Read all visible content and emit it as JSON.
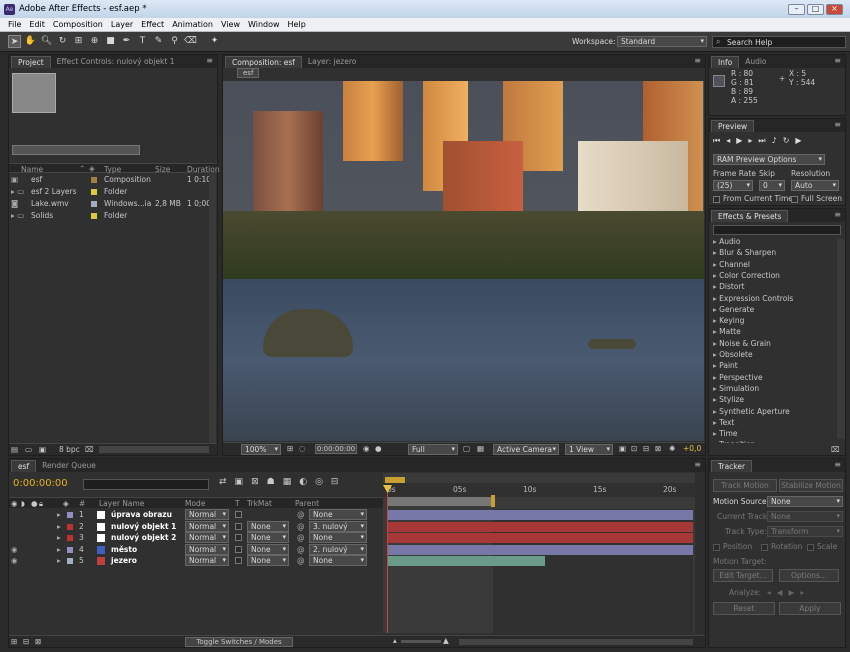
{
  "window": {
    "title": "Adobe After Effects - esf.aep *",
    "app_icon": "Ae"
  },
  "menu": [
    "File",
    "Edit",
    "Composition",
    "Layer",
    "Effect",
    "Animation",
    "View",
    "Window",
    "Help"
  ],
  "toolbar": {
    "workspace_label": "Workspace:",
    "workspace_value": "Standard",
    "search_placeholder": "Search Help"
  },
  "project": {
    "tabs": [
      "Project",
      "Effect Controls: nulový objekt 1"
    ],
    "columns": [
      "Name",
      "Type",
      "Size",
      "Duration"
    ],
    "items": [
      {
        "name": "esf",
        "type": "Composition",
        "size": "",
        "duration": "1 0:10",
        "color": "#a08040",
        "icon": "composition-icon"
      },
      {
        "name": "esf 2 Layers",
        "type": "Folder",
        "size": "",
        "duration": "",
        "color": "#d8c840",
        "icon": "folder-icon"
      },
      {
        "name": "Lake.wmv",
        "type": "Windows...ia",
        "size": "2,8 MB",
        "duration": "1 0;00",
        "color": "#a0b0c0",
        "icon": "video-file-icon"
      },
      {
        "name": "Solids",
        "type": "Folder",
        "size": "",
        "duration": "",
        "color": "#d8c840",
        "icon": "folder-icon"
      }
    ],
    "bpc": "8 bpc"
  },
  "composition": {
    "tabs": [
      "Composition: esf",
      "Layer: jezero"
    ],
    "crumb": "esf",
    "zoom": "100%",
    "timecode": "0:00:00:00",
    "resolution": "Full",
    "camera": "Active Camera",
    "view": "1 View",
    "exposure": "+0,0"
  },
  "info": {
    "tabs": [
      "Info",
      "Audio"
    ],
    "r": "R : 80",
    "g": "G : 81",
    "b": "B : 89",
    "a": "A : 255",
    "x": "X : 5",
    "y": "Y : 544"
  },
  "preview": {
    "title": "Preview",
    "ram": "RAM Preview Options",
    "frame_rate_label": "Frame Rate",
    "skip_label": "Skip",
    "resolution_label": "Resolution",
    "frame_rate": "(25)",
    "skip": "0",
    "resolution": "Auto",
    "from_current": "From Current Time",
    "full_screen": "Full Screen"
  },
  "effects": {
    "title": "Effects & Presets",
    "items": [
      "Audio",
      "Blur & Sharpen",
      "Channel",
      "Color Correction",
      "Distort",
      "Expression Controls",
      "Generate",
      "Keying",
      "Matte",
      "Noise & Grain",
      "Obsolete",
      "Paint",
      "Perspective",
      "Simulation",
      "Stylize",
      "Synthetic Aperture",
      "Text",
      "Time",
      "Transition"
    ]
  },
  "timeline": {
    "tabs": [
      "esf",
      "Render Queue"
    ],
    "timecode": "0:00:00:00",
    "columns": {
      "num": "#",
      "layer_name": "Layer Name",
      "mode": "Mode",
      "t": "T",
      "trkmat": "TrkMat",
      "parent": "Parent"
    },
    "ruler": [
      "0s",
      "05s",
      "10s",
      "15s",
      "20s"
    ],
    "layers": [
      {
        "num": "1",
        "name": "úprava obrazu",
        "color": "#9090c0",
        "mode": "Normal",
        "trkmat": "",
        "parent": "None",
        "bar": "#7878a8"
      },
      {
        "num": "2",
        "name": "nulový objekt 1",
        "color": "#c03030",
        "mode": "Normal",
        "trkmat": "None",
        "parent": "3. nulový",
        "bar": "#a83838"
      },
      {
        "num": "3",
        "name": "nulový objekt 2",
        "color": "#c03030",
        "mode": "Normal",
        "trkmat": "None",
        "parent": "None",
        "bar": "#a83838"
      },
      {
        "num": "4",
        "name": "město",
        "color": "#9090c0",
        "mode": "Normal",
        "trkmat": "None",
        "parent": "2. nulový",
        "bar": "#7878a8"
      },
      {
        "num": "5",
        "name": "jezero",
        "color": "#a0b0c0",
        "mode": "Normal",
        "trkmat": "None",
        "parent": "None",
        "bar": "#6a9a8a"
      }
    ],
    "toggle_label": "Toggle Switches / Modes"
  },
  "tracker": {
    "title": "Tracker",
    "track_motion": "Track Motion",
    "stabilize": "Stabilize Motion",
    "motion_source_label": "Motion Source:",
    "motion_source": "None",
    "current_track_label": "Current Track:",
    "current_track": "None",
    "track_type_label": "Track Type:",
    "track_type": "Transform",
    "position": "Position",
    "rotation": "Rotation",
    "scale": "Scale",
    "motion_target": "Motion Target:",
    "edit_target": "Edit Target...",
    "options": "Options...",
    "analyze": "Analyze:",
    "reset": "Reset",
    "apply": "Apply"
  }
}
